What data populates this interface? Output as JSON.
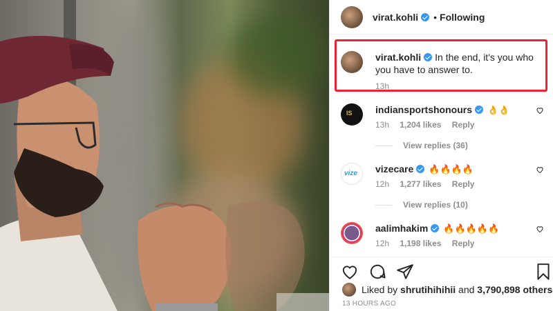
{
  "post_author": {
    "username": "virat.kohli",
    "separator": "•",
    "follow_status": "Following"
  },
  "caption": {
    "username": "virat.kohli",
    "text": "In the end, it's you who you have to answer to.",
    "time": "13h"
  },
  "comments": [
    {
      "username": "indiansportshonours",
      "emoji": "👌👌",
      "time": "13h",
      "likes": "1,204 likes",
      "reply": "Reply",
      "view_replies": "View replies (36)"
    },
    {
      "username": "vizecare",
      "emoji": "🔥🔥🔥🔥",
      "time": "12h",
      "likes": "1,277 likes",
      "reply": "Reply",
      "view_replies": "View replies (10)"
    },
    {
      "username": "aalimhakim",
      "emoji": "🔥🔥🔥🔥🔥",
      "time": "12h",
      "likes": "1,198 likes",
      "reply": "Reply"
    }
  ],
  "likes": {
    "prefix": "Liked by",
    "first_user": "shrutihihihii",
    "middle": "and",
    "others": "3,790,898 others"
  },
  "posted_ago": "13 HOURS AGO",
  "icons": [
    "heart-icon",
    "comment-icon",
    "share-icon",
    "bookmark-icon",
    "verified-badge-icon"
  ],
  "colors": {
    "verified": "#3897f0",
    "highlight_box": "#ee2233",
    "secondary_text": "#8e8e8e"
  }
}
